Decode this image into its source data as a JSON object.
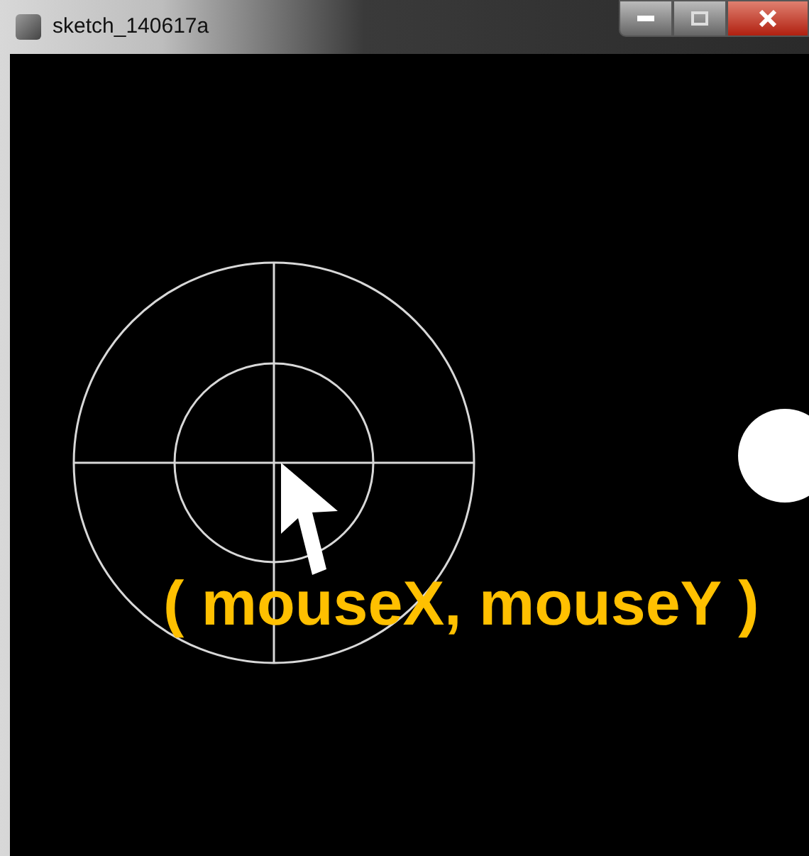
{
  "window": {
    "title": "sketch_140617a"
  },
  "canvas": {
    "annotation": "( mouseX, mouseY )"
  }
}
